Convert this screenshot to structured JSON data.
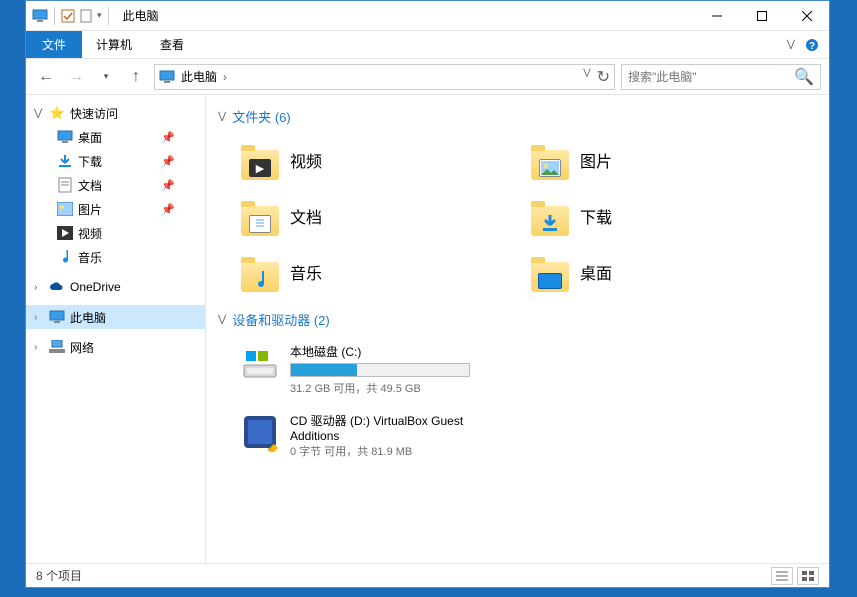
{
  "titlebar": {
    "title": "此电脑"
  },
  "menubar": {
    "file": "文件",
    "computer": "计算机",
    "view": "查看"
  },
  "addressbar": {
    "location": "此电脑",
    "separator": "›"
  },
  "search": {
    "placeholder": "搜索\"此电脑\""
  },
  "sidebar": {
    "quick_access": "快速访问",
    "quick_items": [
      {
        "label": "桌面",
        "pinned": true,
        "icon": "desktop"
      },
      {
        "label": "下载",
        "pinned": true,
        "icon": "download"
      },
      {
        "label": "文档",
        "pinned": true,
        "icon": "document"
      },
      {
        "label": "图片",
        "pinned": true,
        "icon": "picture"
      },
      {
        "label": "视频",
        "pinned": false,
        "icon": "video"
      },
      {
        "label": "音乐",
        "pinned": false,
        "icon": "music"
      }
    ],
    "onedrive": "OneDrive",
    "this_pc": "此电脑",
    "network": "网络"
  },
  "content": {
    "folders_header": "文件夹 (6)",
    "folders": [
      {
        "label": "视频",
        "overlay": "video"
      },
      {
        "label": "图片",
        "overlay": "picture"
      },
      {
        "label": "文档",
        "overlay": "document"
      },
      {
        "label": "下载",
        "overlay": "download"
      },
      {
        "label": "音乐",
        "overlay": "music"
      },
      {
        "label": "桌面",
        "overlay": "desktop"
      }
    ],
    "devices_header": "设备和驱动器 (2)",
    "drives": [
      {
        "label": "本地磁盘 (C:)",
        "sub": "31.2 GB 可用，共 49.5 GB",
        "fill_pct": 37,
        "icon": "hdd"
      },
      {
        "label": "CD 驱动器 (D:) VirtualBox Guest Additions",
        "sub": "0 字节 可用，共 81.9 MB",
        "icon": "cd"
      }
    ]
  },
  "statusbar": {
    "text": "8 个项目"
  },
  "colors": {
    "accent": "#1979ca",
    "folder": "#f9d267"
  }
}
